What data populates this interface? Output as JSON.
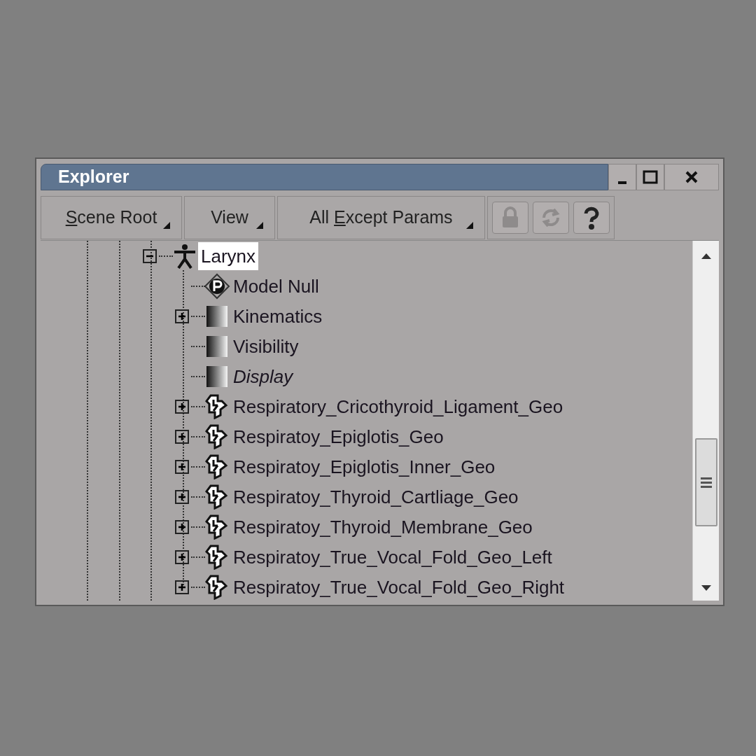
{
  "window": {
    "title": "Explorer"
  },
  "toolbar": {
    "menus": [
      {
        "mnemonic": "S",
        "after": "cene Root"
      },
      {
        "before": "View"
      },
      {
        "before": "All ",
        "mnemonic": "E",
        "after": "xcept Params"
      }
    ],
    "icons": [
      {
        "kind": "lock",
        "disabled": true
      },
      {
        "kind": "refresh",
        "disabled": true
      },
      {
        "kind": "help",
        "disabled": false
      }
    ]
  },
  "tree": {
    "nodes": [
      {
        "label": "Larynx",
        "kind": "model",
        "selected": true,
        "expanded": true,
        "children": [
          {
            "label": "Model Null",
            "kind": "null",
            "selected": false,
            "italic": false
          },
          {
            "label": "Kinematics",
            "kind": "property",
            "selected": false,
            "expanded": false,
            "italic": false
          },
          {
            "label": "Visibility",
            "kind": "property",
            "selected": false,
            "italic": false
          },
          {
            "label": "Display",
            "kind": "property",
            "selected": false,
            "italic": true
          },
          {
            "label": "Respiratory_Cricothyroid_Ligament_Geo",
            "kind": "mesh",
            "selected": false,
            "expanded": false,
            "italic": false
          },
          {
            "label": "Respiratoy_Epiglotis_Geo",
            "kind": "mesh",
            "selected": false,
            "expanded": false,
            "italic": false
          },
          {
            "label": "Respiratoy_Epiglotis_Inner_Geo",
            "kind": "mesh",
            "selected": false,
            "expanded": false,
            "italic": false
          },
          {
            "label": "Respiratoy_Thyroid_Cartliage_Geo",
            "kind": "mesh",
            "selected": false,
            "expanded": false,
            "italic": false
          },
          {
            "label": "Respiratoy_Thyroid_Membrane_Geo",
            "kind": "mesh",
            "selected": false,
            "expanded": false,
            "italic": false
          },
          {
            "label": "Respiratoy_True_Vocal_Fold_Geo_Left",
            "kind": "mesh",
            "selected": false,
            "expanded": false,
            "italic": false
          },
          {
            "label": "Respiratoy_True_Vocal_Fold_Geo_Right",
            "kind": "mesh",
            "selected": false,
            "expanded": false,
            "italic": false
          }
        ]
      }
    ]
  }
}
